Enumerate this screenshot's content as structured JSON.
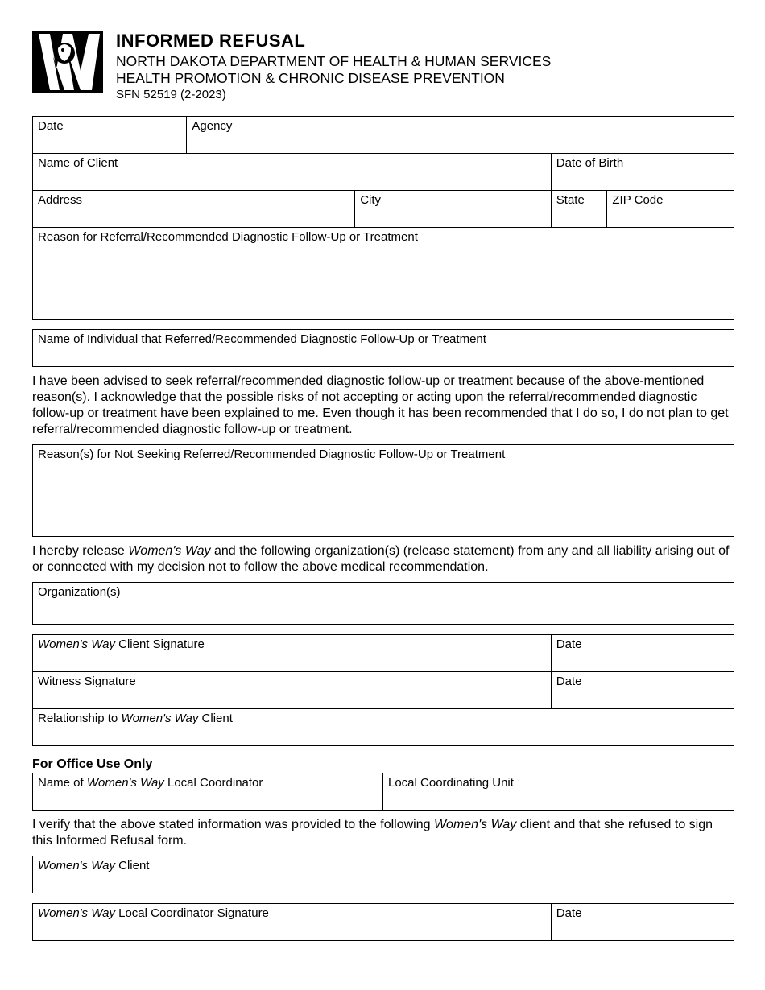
{
  "header": {
    "title": "INFORMED REFUSAL",
    "dept": "NORTH DAKOTA DEPARTMENT OF HEALTH & HUMAN SERVICES",
    "division": "HEALTH PROMOTION & CHRONIC DISEASE PREVENTION",
    "formno": "SFN 52519 (2-2023)"
  },
  "fields": {
    "date": "Date",
    "agency": "Agency",
    "name_of_client": "Name of Client",
    "dob": "Date of Birth",
    "address": "Address",
    "city": "City",
    "state": "State",
    "zip": "ZIP Code",
    "reason_referral": "Reason for Referral/Recommended Diagnostic Follow-Up or Treatment",
    "name_individual": "Name of Individual that Referred/Recommended Diagnostic Follow-Up or Treatment",
    "reason_not_seeking": "Reason(s) for Not Seeking Referred/Recommended Diagnostic Follow-Up or Treatment",
    "organizations": "Organization(s)",
    "client_sig_pre": "Women's Way",
    "client_sig_post": " Client Signature",
    "sig_date": "Date",
    "witness_sig": "Witness Signature",
    "witness_date": "Date",
    "relationship_pre": "Relationship to ",
    "relationship_ww": "Women's Way",
    "relationship_post": " Client",
    "coord_name_pre": "Name of ",
    "coord_name_ww": "Women's Way",
    "coord_name_post": " Local Coordinator",
    "coord_unit": "Local Coordinating Unit",
    "ww_client_pre": "Women's Way",
    "ww_client_post": " Client",
    "coord_sig_pre": "Women's Way",
    "coord_sig_post": " Local Coordinator Signature",
    "coord_sig_date": "Date"
  },
  "paragraphs": {
    "advise": "I have been advised to seek referral/recommended diagnostic follow-up or treatment because of the above-mentioned reason(s). I acknowledge that the possible risks of not accepting or acting upon the referral/recommended diagnostic follow-up or treatment have been explained to me. Even though it has been recommended that I do so, I do not plan to get referral/recommended diagnostic follow-up or treatment.",
    "release_pre": "I hereby release ",
    "release_ww": "Women's Way",
    "release_post": " and the following organization(s) (release statement) from any and all liability arising out of or connected with my decision not to follow the above medical recommendation.",
    "verify_pre": "I verify that the above stated information was provided to the following ",
    "verify_ww": "Women's Way",
    "verify_post": " client and that she refused to sign this Informed Refusal form."
  },
  "section": {
    "office": "For Office Use Only"
  }
}
